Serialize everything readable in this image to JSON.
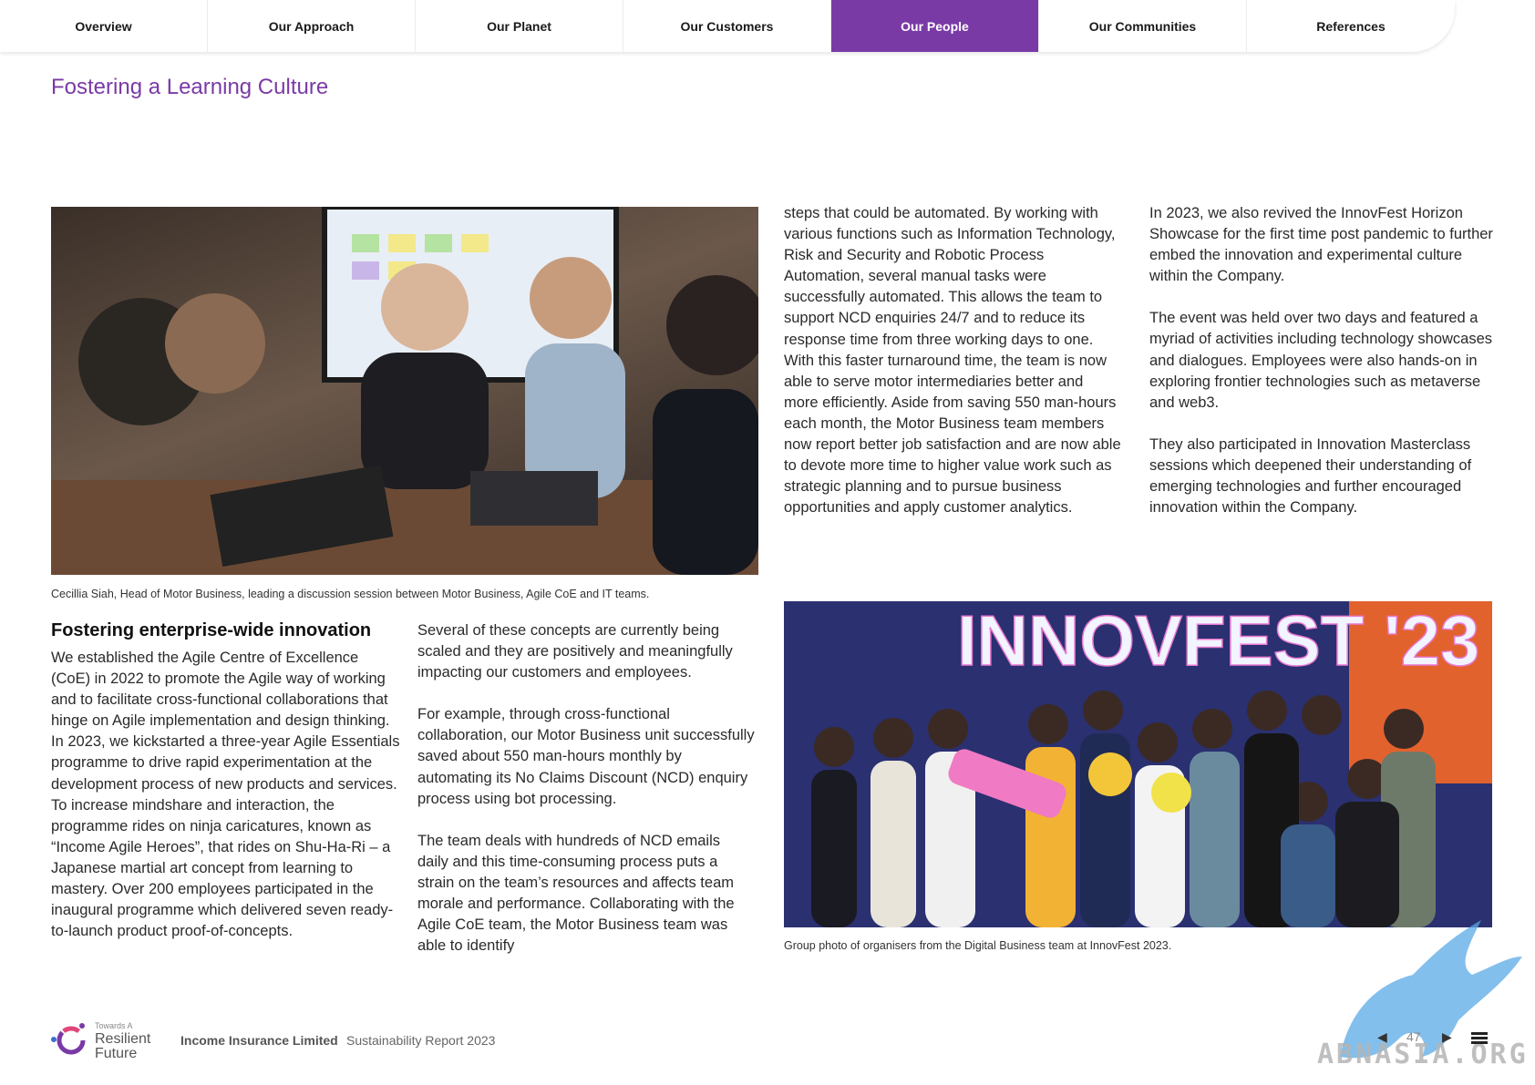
{
  "nav": {
    "tabs": [
      {
        "label": "Overview"
      },
      {
        "label": "Our Approach"
      },
      {
        "label": "Our Planet"
      },
      {
        "label": "Our Customers"
      },
      {
        "label": "Our People"
      },
      {
        "label": "Our Communities"
      },
      {
        "label": "References"
      }
    ],
    "active_index": 4,
    "active_color": "#7a3aa6"
  },
  "page": {
    "title": "Fostering a Learning Culture"
  },
  "photo1": {
    "caption": "Cecillia Siah, Head of Motor Business, leading a discussion session between Motor Business, Agile CoE and IT teams."
  },
  "photo2": {
    "banner_text": "INNOVFEST '23",
    "caption": "Group photo of organisers from the Digital Business team at InnovFest 2023."
  },
  "section": {
    "heading": "Fostering enterprise-wide innovation",
    "col1": [
      "We established the Agile Centre of Excellence (CoE) in 2022 to promote the Agile way of working and to facilitate cross-functional collaborations that hinge on Agile implementation and design thinking. In 2023, we kickstarted a three-year Agile Essentials programme to drive rapid experimentation at the development process of new products and services. To increase mindshare and interaction, the programme rides on ninja caricatures, known as “Income Agile Heroes”, that rides on Shu-Ha-Ri – a Japanese martial art concept from learning to mastery. Over 200 employees participated in the inaugural programme which delivered seven ready-to-launch product proof-of-concepts."
    ],
    "col2": [
      "Several of these concepts are currently being scaled and they are positively and meaningfully impacting our customers and employees.",
      "For example, through cross-functional collaboration, our Motor Business unit successfully saved about 550 man-hours monthly by automating its No Claims Discount (NCD) enquiry process using bot processing.",
      "The team deals with hundreds of NCD emails daily and this time-consuming process puts a strain on the team’s resources and affects team morale and performance. Collaborating with the Agile CoE team, the Motor Business team was able to identify"
    ],
    "col3": [
      "steps that could be automated. By working with various functions such as Information Technology, Risk and Security and Robotic Process Automation, several manual tasks were successfully automated. This allows the team to support NCD enquiries 24/7 and to reduce its response time from three working days to one. With this faster turnaround time, the team is now able to serve motor intermediaries better and more efficiently. Aside from saving 550 man-hours each month, the Motor Business team members now report better job satisfaction and are now able to devote more time to higher value work such as strategic planning and to pursue business opportunities and apply customer analytics."
    ],
    "col4": [
      "In 2023, we also revived the InnovFest Horizon Showcase for the first time post pandemic to further embed the innovation and experimental culture within the Company.",
      "The event was held over two days and featured a myriad of activities including technology showcases and dialogues. Employees were also hands-on in exploring frontier technologies such as metaverse and web3.",
      "They also participated in Innovation Masterclass sessions which deepened their understanding of emerging technologies and further encouraged innovation within the Company."
    ]
  },
  "footer": {
    "logo_small": "Towards A",
    "logo_line1": "Resilient",
    "logo_line2": "Future",
    "company": "Income Insurance Limited",
    "report": "Sustainability Report 2023",
    "page_number": "47",
    "prev_icon": "triangle-left-icon",
    "next_icon": "triangle-right-icon",
    "menu_icon": "hamburger-menu-icon"
  },
  "watermark": {
    "text": "ABNASIA.ORG"
  }
}
